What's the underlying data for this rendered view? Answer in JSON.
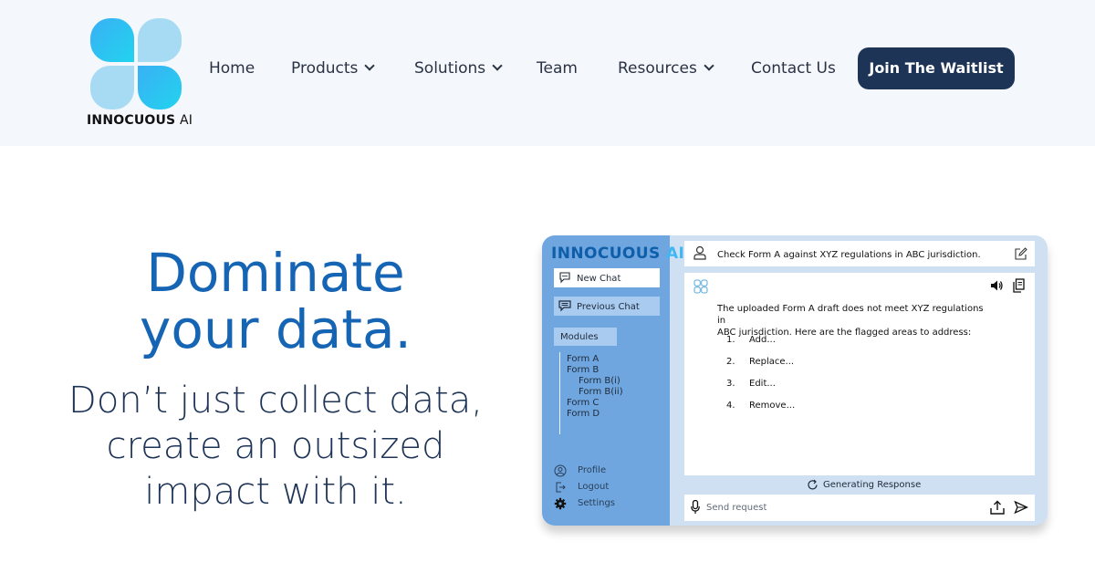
{
  "brand": {
    "logo_text_bold": "INNOCUOUS",
    "logo_text_light": "AI",
    "colors": {
      "primary": "#1565b4",
      "navy": "#1e3457",
      "cyan": "#40b6f2",
      "light_blue": "#a7dbf4"
    }
  },
  "nav": {
    "items": [
      {
        "label": "Home",
        "has_dropdown": false
      },
      {
        "label": "Products",
        "has_dropdown": true
      },
      {
        "label": "Solutions",
        "has_dropdown": true
      },
      {
        "label": "Team",
        "has_dropdown": false
      },
      {
        "label": "Resources",
        "has_dropdown": true
      },
      {
        "label": "Contact Us",
        "has_dropdown": false
      }
    ],
    "cta_label": "Join The Waitlist"
  },
  "hero": {
    "title_line1": "Dominate",
    "title_line2": "your data.",
    "subtitle_line1": "Don’t just collect data,",
    "subtitle_line2": "create an outsized",
    "subtitle_line3": "impact with it."
  },
  "app": {
    "brand_main": "INNOCUOUS",
    "brand_ai": "AI",
    "new_chat": "New Chat",
    "previous_chat": "Previous Chat",
    "modules_label": "Modules",
    "modules": [
      "Form A",
      "Form B",
      "Form B(i)",
      "Form B(ii)",
      "Form C",
      "Form D"
    ],
    "footer": {
      "profile": "Profile",
      "logout": "Logout",
      "settings": "Settings"
    },
    "user_query": "Check Form A against XYZ regulations in ABC jurisdiction.",
    "response_line1": "The uploaded Form A draft does not meet XYZ regulations in",
    "response_line2": "ABC jurisdiction. Here are the flagged areas to address:",
    "steps": [
      {
        "num": "1.",
        "text": "Add..."
      },
      {
        "num": "2.",
        "text": "Replace..."
      },
      {
        "num": "3.",
        "text": "Edit..."
      },
      {
        "num": "4.",
        "text": "Remove..."
      }
    ],
    "status": "Generating Response",
    "input_placeholder": "Send request"
  }
}
